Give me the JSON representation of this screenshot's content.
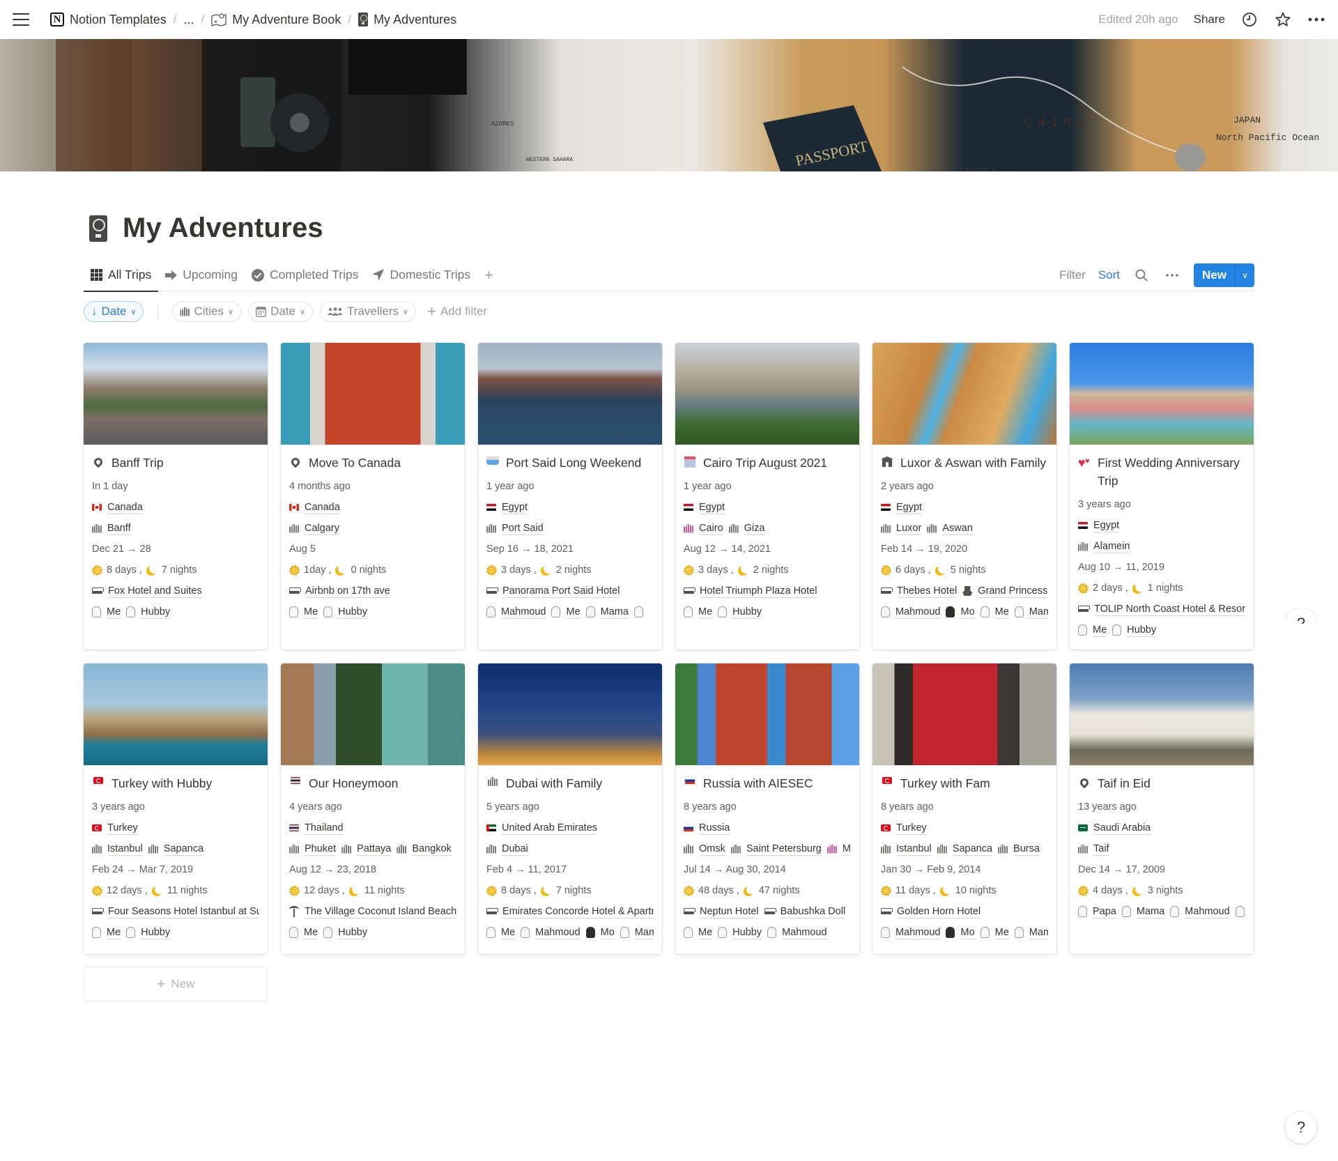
{
  "topbar": {
    "breadcrumbs": [
      {
        "label": "Notion Templates",
        "icon": "notion-logo-icon"
      },
      {
        "label": "...",
        "icon": null
      },
      {
        "label": "My Adventure Book",
        "icon": "treasure-map-icon"
      },
      {
        "label": "My Adventures",
        "icon": "passport-icon"
      }
    ],
    "edited": "Edited 20h ago",
    "share": "Share",
    "icons": [
      "history-clock-icon",
      "favorite-star-icon",
      "more-dots-icon"
    ]
  },
  "page": {
    "title": "My Adventures",
    "icon": "passport-icon"
  },
  "views": {
    "tabs": [
      {
        "label": "All Trips",
        "icon": "grid-icon",
        "active": true
      },
      {
        "label": "Upcoming",
        "icon": "arrow-right-icon",
        "active": false
      },
      {
        "label": "Completed Trips",
        "icon": "check-circle-icon",
        "active": false
      },
      {
        "label": "Domestic Trips",
        "icon": "navigation-arrow-icon",
        "active": false
      }
    ],
    "add_view": "+",
    "filter": "Filter",
    "sort": "Sort",
    "new": "New"
  },
  "filters": {
    "sort_pill": "Date",
    "pills": [
      {
        "label": "Cities",
        "icon": "city-icon"
      },
      {
        "label": "Date",
        "icon": "calendar-icon"
      },
      {
        "label": "Travellers",
        "icon": "people-icon"
      }
    ],
    "add_filter": "Add filter"
  },
  "colors": {
    "accent": "#2383e2",
    "sort_blue": "#2e7dd1",
    "text": "#37352f",
    "muted": "#787774"
  },
  "cards": [
    {
      "title": "Banff Trip",
      "title_icon": "pin",
      "image": "banff-street-mountains",
      "relative": "In 1 day",
      "country": {
        "name": "Canada",
        "flag": "ca"
      },
      "cities": [
        {
          "name": "Banff"
        }
      ],
      "dates": "Dec 21 → 28",
      "days": "8 days",
      "nights": "7 nights",
      "stays": [
        {
          "name": "Fox Hotel and Suites",
          "icon": "bed"
        }
      ],
      "travellers": [
        "Me",
        "Hubby"
      ]
    },
    {
      "title": "Move To Canada",
      "title_icon": "pin",
      "image": "canada-flag-bicycle",
      "relative": "4 months ago",
      "country": {
        "name": "Canada",
        "flag": "ca"
      },
      "cities": [
        {
          "name": "Calgary"
        }
      ],
      "dates": "Aug 5",
      "days": "1day",
      "nights": "0 nights",
      "stays": [
        {
          "name": "Airbnb on 17th ave",
          "icon": "bed"
        }
      ],
      "travellers": [
        "Me",
        "Hubby"
      ]
    },
    {
      "title": "Port Said Long Weekend",
      "title_icon": "ship",
      "image": "container-ship",
      "relative": "1 year ago",
      "country": {
        "name": "Egypt",
        "flag": "eg"
      },
      "cities": [
        {
          "name": "Port Said"
        }
      ],
      "dates": "Sep 16 → 18, 2021",
      "days": "3 days",
      "nights": "2 nights",
      "stays": [
        {
          "name": "Panorama Port Said Hotel",
          "icon": "bed"
        }
      ],
      "travellers": [
        "Mahmoud",
        "Me",
        "Mama",
        ""
      ]
    },
    {
      "title": "Cairo Trip August 2021",
      "title_icon": "hotel",
      "image": "cairo-nile",
      "relative": "1 year ago",
      "country": {
        "name": "Egypt",
        "flag": "eg"
      },
      "cities": [
        {
          "name": "Cairo",
          "pink": true
        },
        {
          "name": "Giza"
        }
      ],
      "dates": "Aug 12 → 14, 2021",
      "days": "3 days",
      "nights": "2 nights",
      "stays": [
        {
          "name": "Hotel Triumph Plaza Hotel",
          "icon": "bed"
        }
      ],
      "travellers": [
        "Me",
        "Hubby"
      ]
    },
    {
      "title": "Luxor & Aswan with Family",
      "title_icon": "temple",
      "image": "luxor-columns",
      "relative": "2 years ago",
      "country": {
        "name": "Egypt",
        "flag": "eg"
      },
      "cities": [
        {
          "name": "Luxor"
        },
        {
          "name": "Aswan"
        }
      ],
      "dates": "Feb 14 → 19, 2020",
      "days": "6 days",
      "nights": "5 nights",
      "stays": [
        {
          "name": "Thebes Hotel",
          "icon": "bed"
        },
        {
          "name": "Grand Princess Cruise",
          "icon": "boat"
        }
      ],
      "travellers": [
        "Mahmoud",
        "Mo",
        "Me",
        "Mama"
      ]
    },
    {
      "title": "First Wedding Anniversary Trip",
      "title_icon": "hearts",
      "image": "alamein-resort",
      "relative": "3 years ago",
      "country": {
        "name": "Egypt",
        "flag": "eg"
      },
      "cities": [
        {
          "name": "Alamein"
        }
      ],
      "dates": "Aug 10 → 11, 2019",
      "days": "2 days",
      "nights": "1 nights",
      "stays": [
        {
          "name": "TOLIP North Coast Hotel & Resort",
          "icon": "bed"
        }
      ],
      "travellers": [
        "Me",
        "Hubby"
      ]
    },
    {
      "title": "Turkey with Hubby",
      "title_icon": "flag-tr",
      "image": "istanbul-skyline",
      "relative": "3 years ago",
      "country": {
        "name": "Turkey",
        "flag": "tr"
      },
      "cities": [
        {
          "name": "Istanbul"
        },
        {
          "name": "Sapanca"
        }
      ],
      "dates": "Feb 24 → Mar 7, 2019",
      "days": "12 days",
      "nights": "11 nights",
      "stays": [
        {
          "name": "Four Seasons Hotel Istanbul at Sultanahmet",
          "icon": "bed"
        }
      ],
      "travellers": [
        "Me",
        "Hubby"
      ]
    },
    {
      "title": "Our Honeymoon",
      "title_icon": "flag-th",
      "image": "thai-beach",
      "relative": "4 years ago",
      "country": {
        "name": "Thailand",
        "flag": "th"
      },
      "cities": [
        {
          "name": "Phuket"
        },
        {
          "name": "Pattaya"
        },
        {
          "name": "Bangkok"
        }
      ],
      "dates": "Aug 12 → 23, 2018",
      "days": "12 days",
      "nights": "11 nights",
      "stays": [
        {
          "name": "The Village Coconut Island Beach Resort",
          "icon": "palm"
        }
      ],
      "travellers": [
        "Me",
        "Hubby"
      ]
    },
    {
      "title": "Dubai with Family",
      "title_icon": "city",
      "image": "dubai-night",
      "relative": "5 years ago",
      "country": {
        "name": "United Arab Emirates",
        "flag": "ae"
      },
      "cities": [
        {
          "name": "Dubai"
        }
      ],
      "dates": "Feb 4 → 11, 2017",
      "days": "8 days",
      "nights": "7 nights",
      "stays": [
        {
          "name": "Emirates Concorde Hotel & Apartments",
          "icon": "bed"
        }
      ],
      "travellers": [
        "Me",
        "Mahmoud",
        "Mo",
        "Mama"
      ]
    },
    {
      "title": "Russia with AIESEC",
      "title_icon": "flag-ru",
      "image": "moscow-cathedral",
      "relative": "8 years ago",
      "country": {
        "name": "Russia",
        "flag": "ru"
      },
      "cities": [
        {
          "name": "Omsk"
        },
        {
          "name": "Saint Petersburg"
        },
        {
          "name": "Moscow",
          "pink": true
        }
      ],
      "dates": "Jul 14 → Aug 30, 2014",
      "days": "48 days",
      "nights": "47 nights",
      "stays": [
        {
          "name": "Neptun Hotel",
          "icon": "bed"
        },
        {
          "name": "Babushka Doll",
          "icon": "bed"
        }
      ],
      "travellers": [
        "Me",
        "Hubby",
        "Mahmoud"
      ]
    },
    {
      "title": "Turkey with Fam",
      "title_icon": "flag-tr",
      "image": "istanbul-tram",
      "relative": "8 years ago",
      "country": {
        "name": "Turkey",
        "flag": "tr"
      },
      "cities": [
        {
          "name": "Istanbul"
        },
        {
          "name": "Sapanca"
        },
        {
          "name": "Bursa"
        }
      ],
      "dates": "Jan 30 → Feb 9, 2014",
      "days": "11 days",
      "nights": "10 nights",
      "stays": [
        {
          "name": "Golden Horn Hotel",
          "icon": "bed"
        }
      ],
      "travellers": [
        "Mahmoud",
        "Mo",
        "Me",
        "Mama"
      ]
    },
    {
      "title": "Taif in Eid",
      "title_icon": "pin",
      "image": "taif-white-building",
      "relative": "13 years ago",
      "country": {
        "name": "Saudi Arabia",
        "flag": "sa"
      },
      "cities": [
        {
          "name": "Taif"
        }
      ],
      "dates": "Dec 14 → 17, 2009",
      "days": "4 days",
      "nights": "3 nights",
      "stays": [],
      "travellers": [
        "Papa",
        "Mama",
        "Mahmoud",
        ""
      ]
    }
  ],
  "new_card": "New",
  "help": "?"
}
